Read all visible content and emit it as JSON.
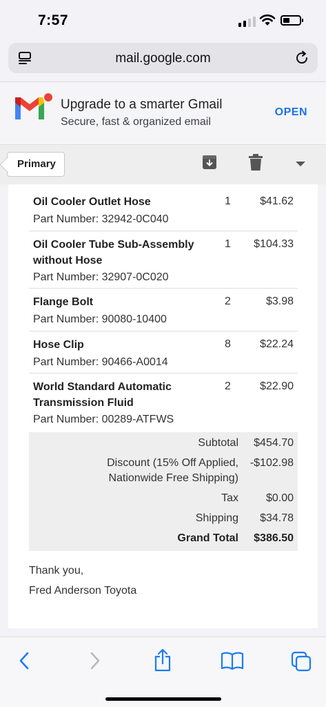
{
  "status_bar": {
    "time": "7:57"
  },
  "browser": {
    "url": "mail.google.com"
  },
  "banner": {
    "title": "Upgrade to a smarter Gmail",
    "subtitle": "Secure, fast & organized email",
    "open_label": "OPEN"
  },
  "toolbar": {
    "label_chip": "Primary"
  },
  "order": {
    "items": [
      {
        "name": "Oil Cooler Outlet Hose",
        "part_number": "Part Number: 32942-0C040",
        "qty": "1",
        "price": "$41.62"
      },
      {
        "name": "Oil Cooler Tube Sub-Assembly without Hose",
        "part_number": "Part Number: 32907-0C020",
        "qty": "1",
        "price": "$104.33"
      },
      {
        "name": "Flange Bolt",
        "part_number": "Part Number: 90080-10400",
        "qty": "2",
        "price": "$3.98"
      },
      {
        "name": "Hose Clip",
        "part_number": "Part Number: 90466-A0014",
        "qty": "8",
        "price": "$22.24"
      },
      {
        "name": "World Standard Automatic Transmission Fluid",
        "part_number": "Part Number: 00289-ATFWS",
        "qty": "2",
        "price": "$22.90"
      }
    ],
    "totals": {
      "subtotal_label": "Subtotal",
      "subtotal": "$454.70",
      "discount_label_1": "Discount (15% Off Applied,",
      "discount_label_2": "Nationwide Free Shipping)",
      "discount": "-$102.98",
      "tax_label": "Tax",
      "tax": "$0.00",
      "shipping_label": "Shipping",
      "shipping": "$34.78",
      "grand_total_label": "Grand Total",
      "grand_total": "$386.50"
    },
    "closing": "Thank you,",
    "signature": "Fred Anderson Toyota"
  },
  "colors": {
    "gmail_open": "#1a73e8",
    "notification_dot": "#ea4335",
    "ios_blue": "#1a7cf5"
  }
}
